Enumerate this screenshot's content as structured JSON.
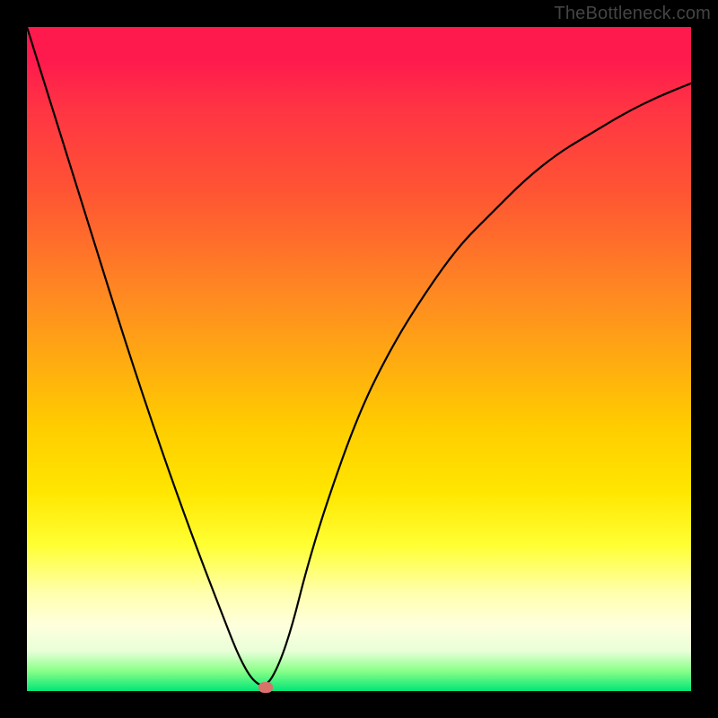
{
  "watermark": "TheBottleneck.com",
  "chart_data": {
    "type": "line",
    "title": "",
    "xlabel": "",
    "ylabel": "",
    "xlim": [
      0,
      100
    ],
    "ylim": [
      0,
      100
    ],
    "background_gradient": {
      "top": "#ff1a4d",
      "mid": "#ffcc00",
      "bottom": "#00e676",
      "meaning": "High value (top, red) to low/optimal value (bottom, green)"
    },
    "series": [
      {
        "name": "bottleneck-curve",
        "x": [
          0,
          5,
          10,
          15,
          20,
          25,
          30,
          32,
          34,
          36,
          38,
          40,
          42,
          45,
          50,
          55,
          60,
          65,
          70,
          75,
          80,
          85,
          90,
          95,
          100
        ],
        "values": [
          100,
          84,
          68,
          52,
          37,
          23,
          10,
          5,
          1.5,
          0.5,
          4,
          10,
          18,
          28,
          42,
          52,
          60,
          67,
          72,
          77,
          81,
          84,
          87,
          89.5,
          91.5
        ]
      }
    ],
    "annotations": [
      {
        "name": "optimal-point-marker",
        "x": 36,
        "y": 0.5,
        "shape": "rounded-dot",
        "color": "#d9726b"
      }
    ]
  }
}
